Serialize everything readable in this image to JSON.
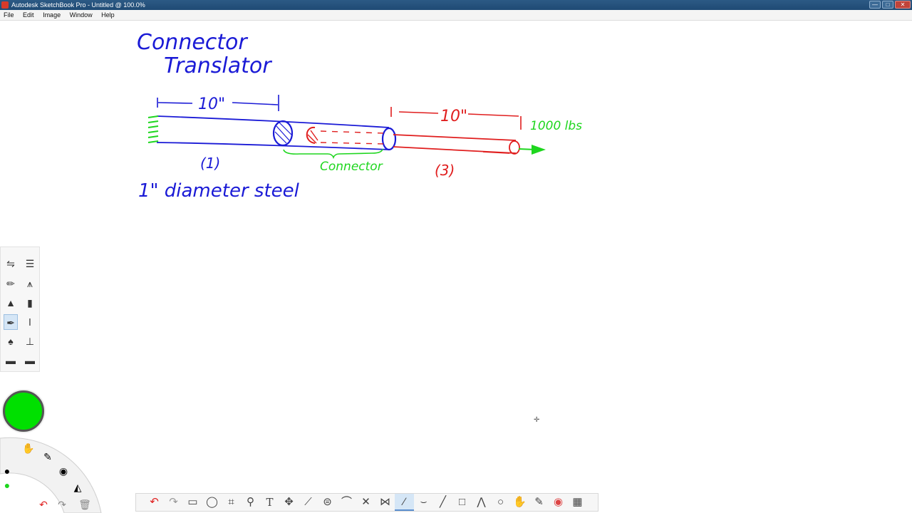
{
  "window": {
    "title": "Autodesk SketchBook Pro - Untitled @ 100.0%",
    "buttons": [
      "—",
      "□",
      "✕"
    ]
  },
  "menubar": {
    "items": [
      "File",
      "Edit",
      "Image",
      "Window",
      "Help"
    ]
  },
  "sketch": {
    "title_line1": "Connector",
    "title_line2": "Translator",
    "dim_left": "10\"",
    "dim_right": "10\"",
    "load": "1000 lbs",
    "label_connector": "Connector",
    "label_part1": "(1)",
    "label_part3": "(3)",
    "note": "1\" diameter steel",
    "colors": {
      "blue": "#1a1ad6",
      "red": "#e01e1e",
      "green": "#1ed61e"
    }
  },
  "toolbox": {
    "top_icons": [
      "sliders-icon",
      "panel-icon"
    ],
    "tools": [
      "pencil",
      "ballpoint",
      "marker",
      "felt-pen",
      "brush",
      "airbrush",
      "pen",
      "chisel",
      "smudge",
      "eraser"
    ]
  },
  "puck": {
    "current_color": "#00e000"
  },
  "bottom_toolbar": {
    "icons": [
      "undo-icon",
      "redo-icon",
      "select-rect-icon",
      "lasso-icon",
      "crop-icon",
      "zoom-icon",
      "text-icon",
      "move-icon",
      "ruler-icon",
      "ellipse-guide-icon",
      "french-curve-icon",
      "symmetry-x-icon",
      "symmetry-y-icon",
      "polyline-icon",
      "curve-icon",
      "line-icon",
      "rectangle-icon",
      "freeform-icon",
      "ellipse-icon",
      "copic-icon",
      "brushes-icon",
      "color-wheel-icon",
      "layers-icon"
    ],
    "glyphs": [
      "↶",
      "↷",
      "▭",
      "◯",
      "⌗",
      "⚲",
      "T",
      "✥",
      "⟋",
      "⊜",
      "⌒",
      "✕",
      "⋈",
      "∕",
      "⌣",
      "╱",
      "□",
      "⋀",
      "○",
      "✋",
      "✎",
      "◉",
      "▦"
    ],
    "selected_index": 13
  }
}
